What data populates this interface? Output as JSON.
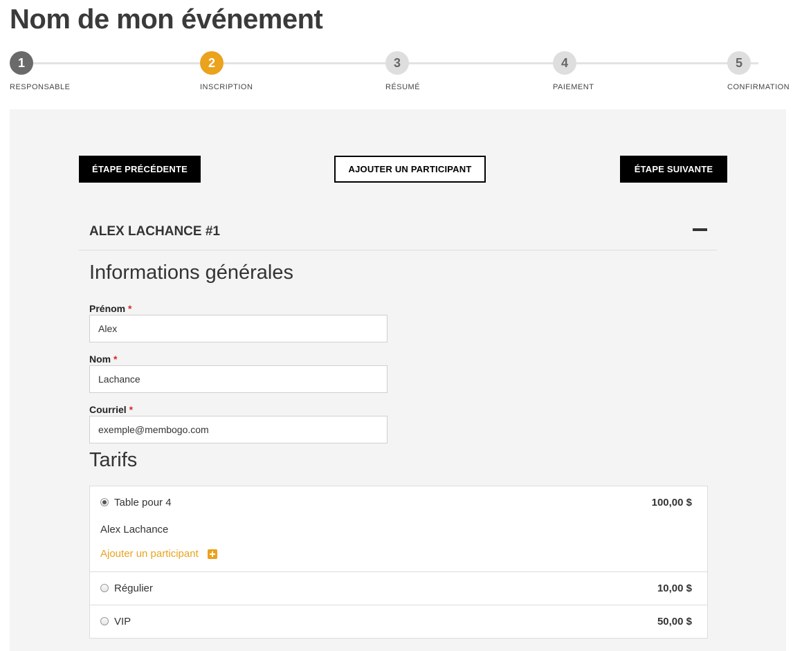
{
  "event": {
    "title": "Nom de mon événement"
  },
  "steps": [
    {
      "number": "1",
      "label": "RESPONSABLE",
      "state": "done"
    },
    {
      "number": "2",
      "label": "INSCRIPTION",
      "state": "active"
    },
    {
      "number": "3",
      "label": "RÉSUMÉ",
      "state": "pending"
    },
    {
      "number": "4",
      "label": "PAIEMENT",
      "state": "pending"
    },
    {
      "number": "5",
      "label": "CONFIRMATION",
      "state": "pending"
    }
  ],
  "actions": {
    "previous_label": "ÉTAPE PRÉCÉDENTE",
    "add_participant_label": "AJOUTER UN PARTICIPANT",
    "next_label": "ÉTAPE SUIVANTE"
  },
  "participant": {
    "header": "ALEX LACHANCE #1",
    "collapse_icon": "minus-icon",
    "general_title": "Informations générales",
    "required_marker": "*",
    "fields": {
      "first_name": {
        "label": "Prénom",
        "value": "Alex"
      },
      "last_name": {
        "label": "Nom",
        "value": "Lachance"
      },
      "email": {
        "label": "Courriel",
        "value": "exemple@membogo.com"
      }
    },
    "tarifs_title": "Tarifs",
    "tarifs": [
      {
        "name": "Table pour 4",
        "price": "100,00 $",
        "selected": true,
        "participant": "Alex Lachance",
        "add_link": "Ajouter un participant"
      },
      {
        "name": "Régulier",
        "price": "10,00 $",
        "selected": false
      },
      {
        "name": "VIP",
        "price": "50,00 $",
        "selected": false
      }
    ]
  },
  "colors": {
    "accent": "#eba21d",
    "done": "#6a6a6a",
    "pending": "#dedede",
    "required": "#d9262b",
    "panel": "#f4f4f4"
  }
}
